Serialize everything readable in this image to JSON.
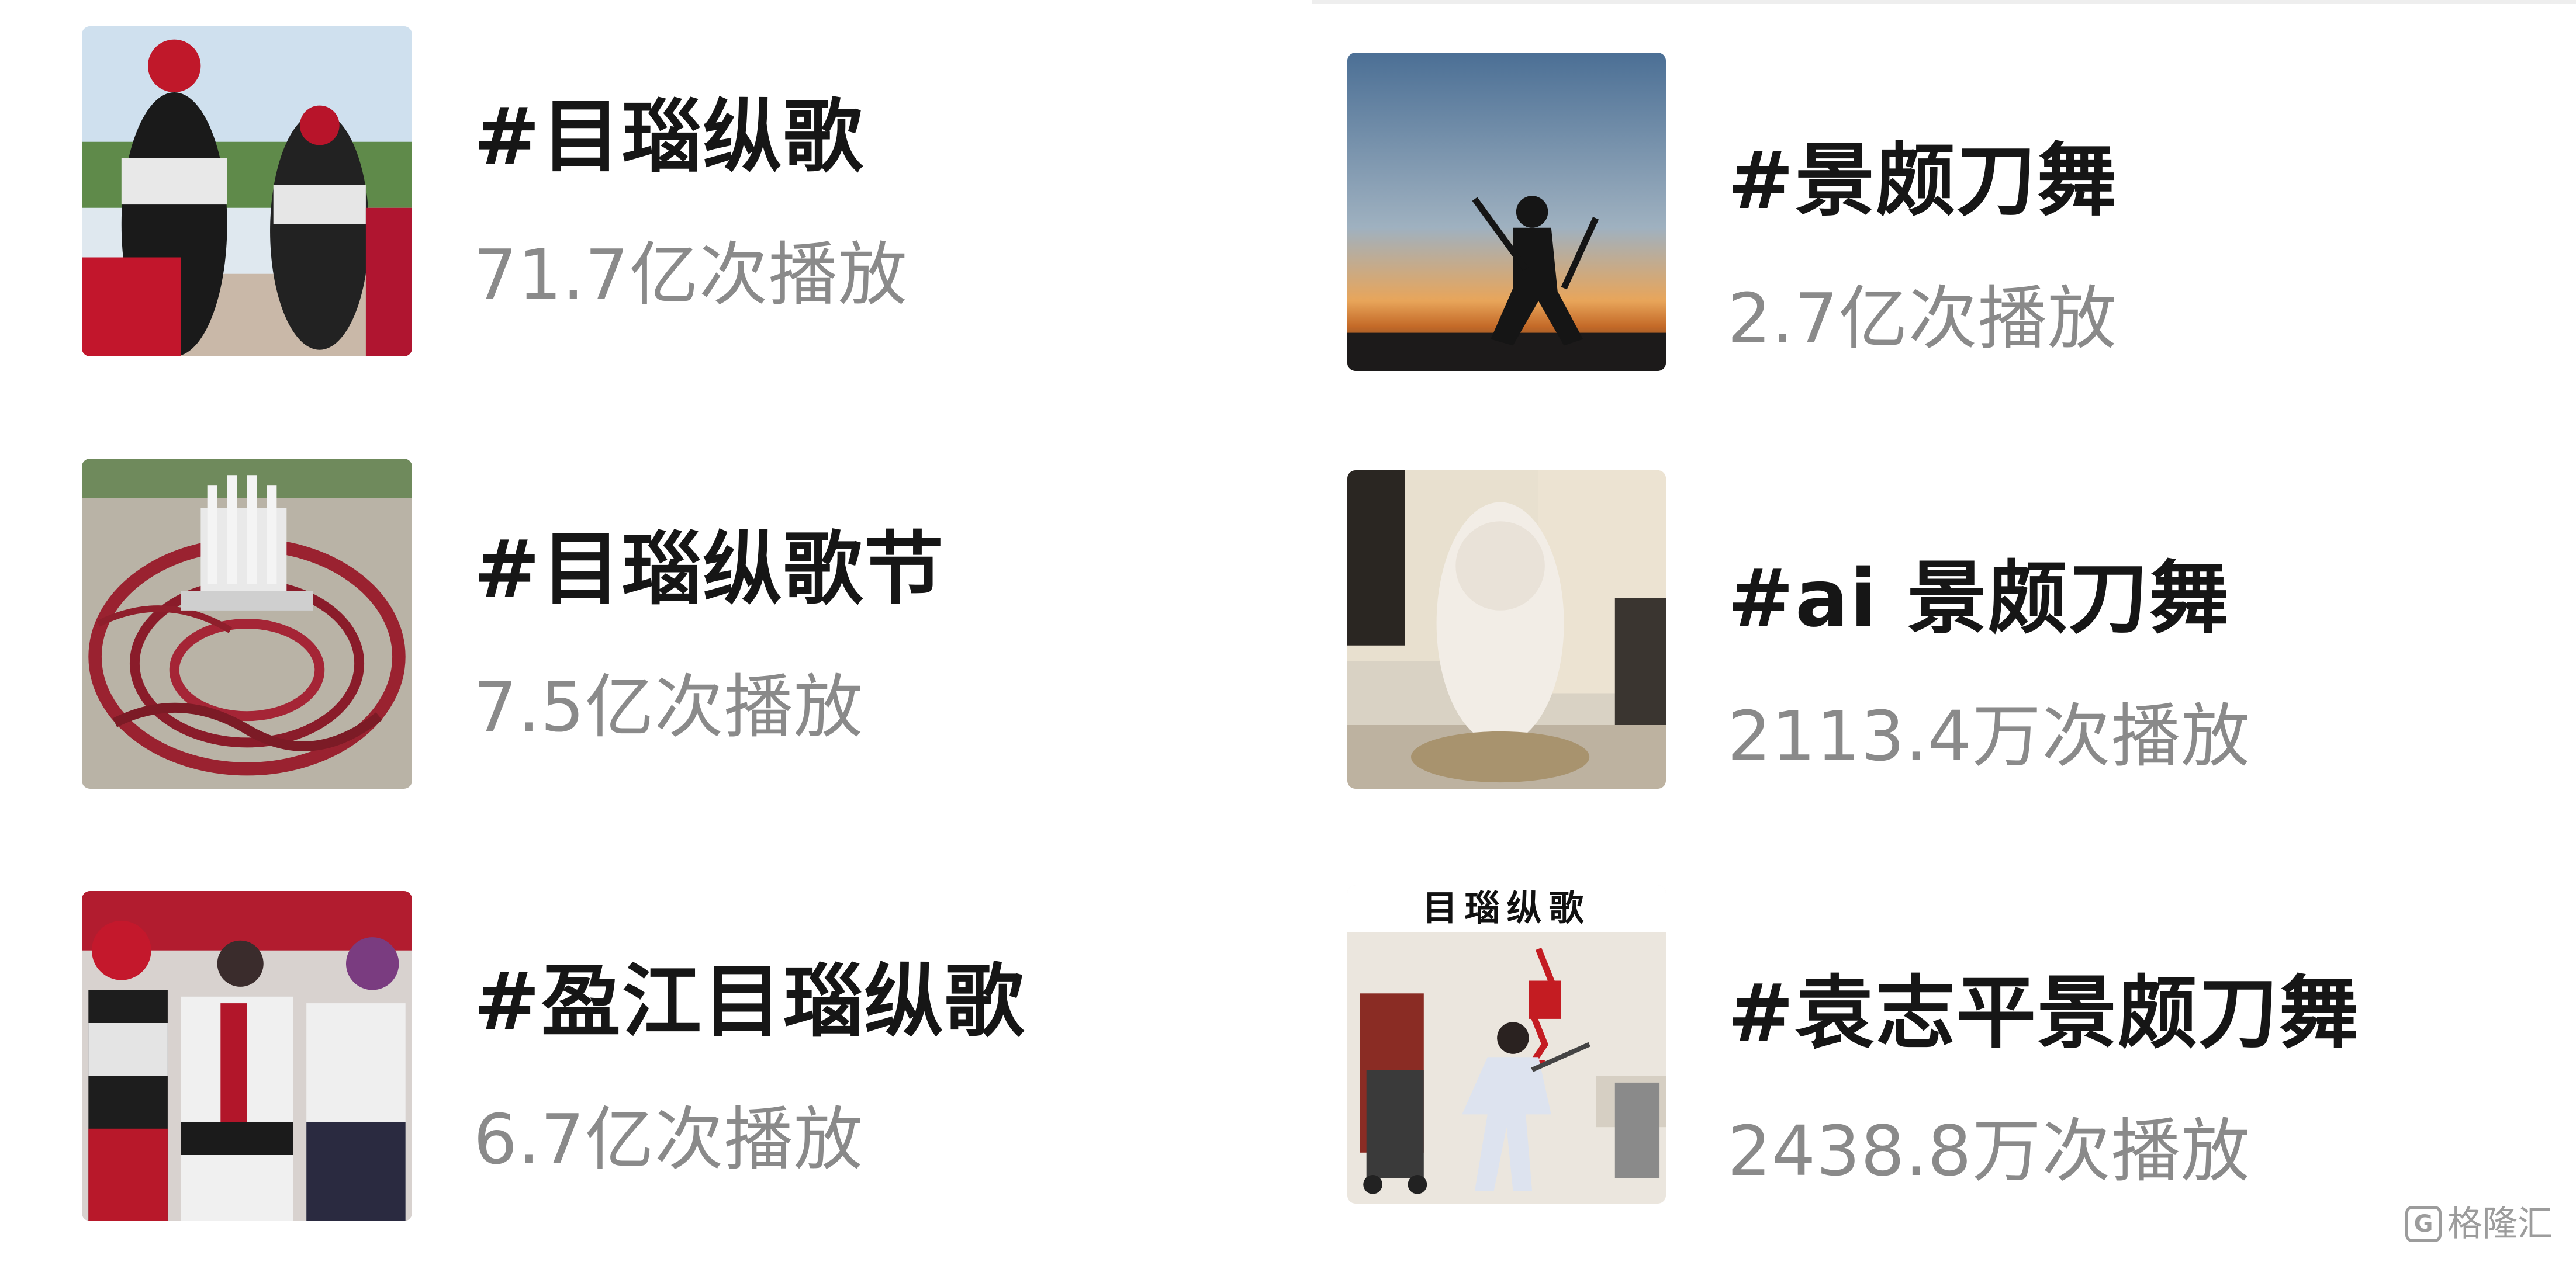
{
  "topics": {
    "left": [
      {
        "title": "#目瑙纵歌",
        "plays": "71.7亿次播放"
      },
      {
        "title": "#目瑙纵歌节",
        "plays": "7.5亿次播放"
      },
      {
        "title": "#盈江目瑙纵歌",
        "plays": "6.7亿次播放"
      }
    ],
    "right": [
      {
        "title": "#景颇刀舞",
        "plays": "2.7亿次播放"
      },
      {
        "title": "#ai 景颇刀舞",
        "plays": "2113.4万次播放"
      },
      {
        "title": "#袁志平景颇刀舞",
        "plays": "2438.8万次播放",
        "thumb_caption": "目瑙纵歌"
      }
    ]
  },
  "watermark": {
    "text": "格隆汇",
    "icon": "g-logo-icon"
  },
  "colors": {
    "title": "#161616",
    "plays": "#8a8a8a",
    "background": "#ffffff"
  }
}
